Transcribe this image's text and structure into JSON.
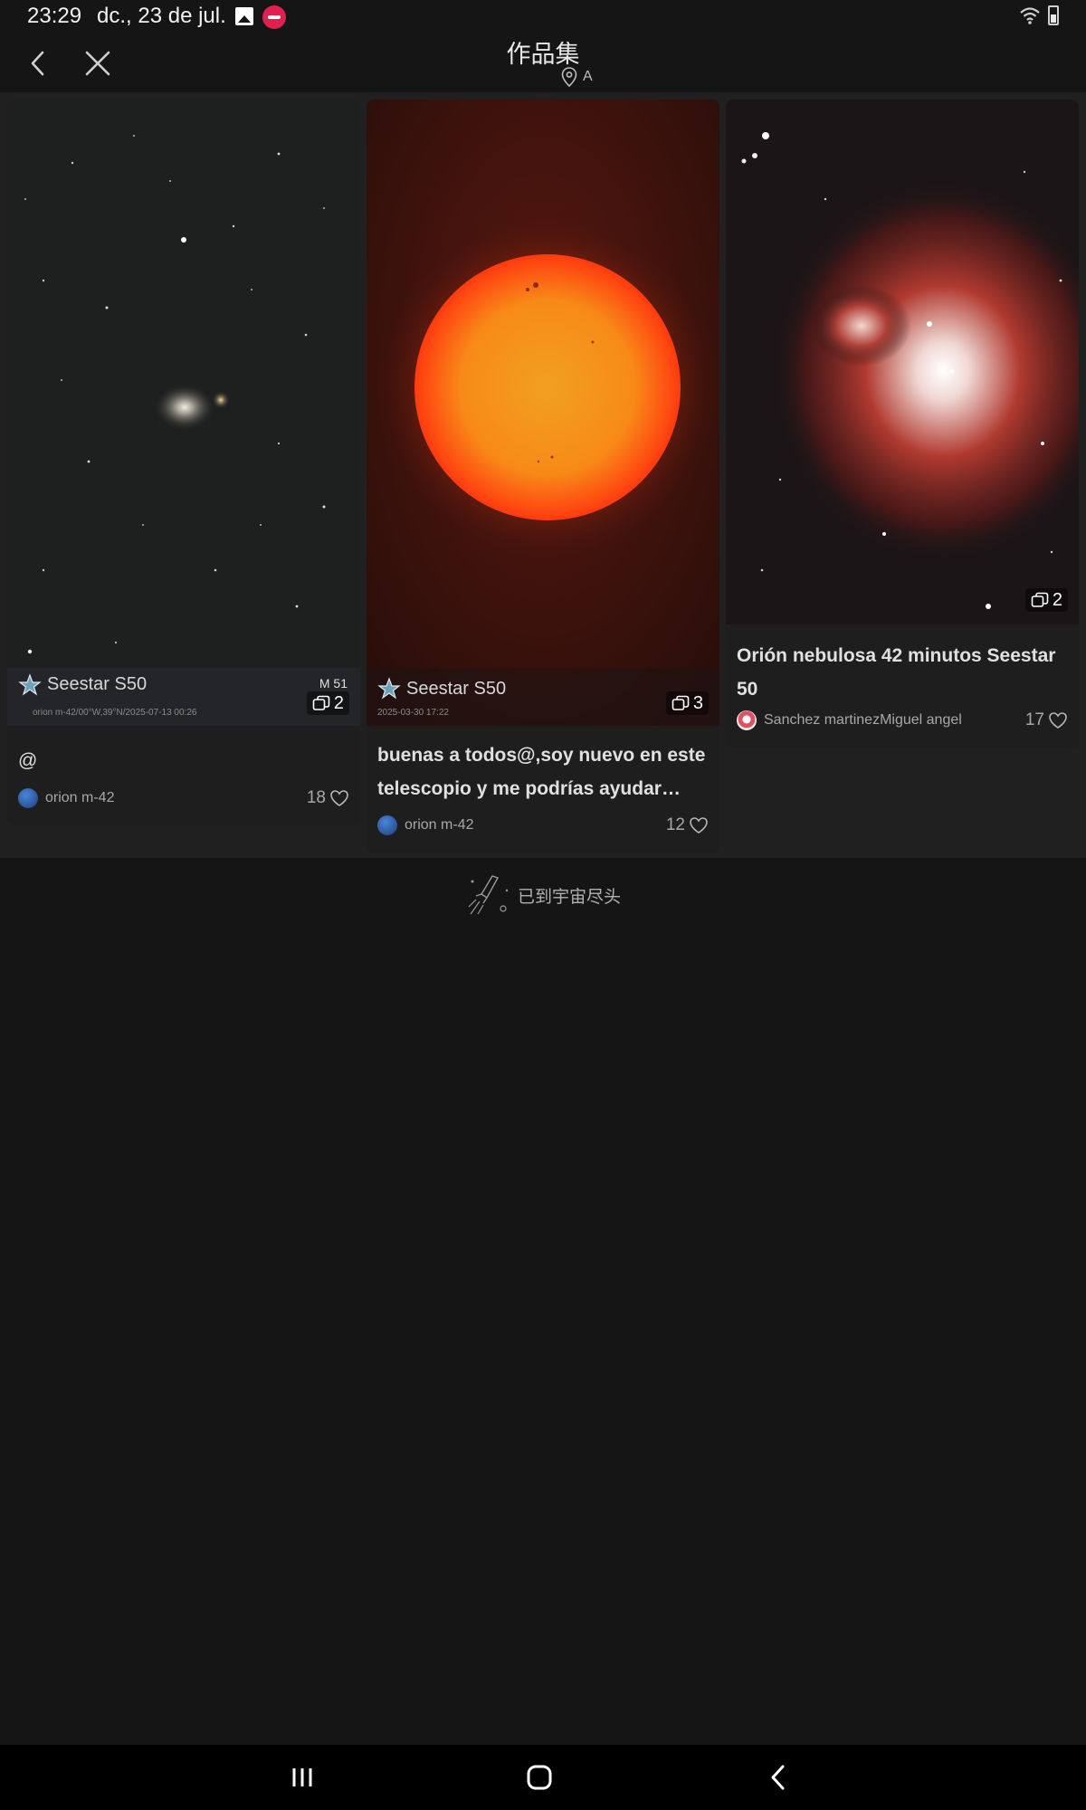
{
  "status_bar": {
    "time": "23:29",
    "date": "dc., 23 de jul."
  },
  "header": {
    "title": "作品集",
    "location": "A"
  },
  "cards": [
    {
      "watermark_brand": "Seestar S50",
      "watermark_target": "M 51",
      "watermark_info": "orion m-42/00°W,39°N/2025-07-13 00:26",
      "photo_count": "2",
      "title": "@",
      "author": "orion m-42",
      "likes": "18"
    },
    {
      "watermark_brand": "Seestar S50",
      "watermark_info": "2025-03-30 17:22",
      "photo_count": "3",
      "title": "buenas a todos@,soy nuevo en este telescopio y me podrías ayudar…",
      "author": "orion m-42",
      "likes": "12"
    },
    {
      "photo_count": "2",
      "title": "Orión nebulosa 42 minutos Seestar 50",
      "author": "Sanchez martinezMiguel angel",
      "likes": "17"
    }
  ],
  "end_message": "已到宇宙尽头",
  "colors": {
    "background": "#151515",
    "feed_background": "#202020",
    "card_background": "#1e1e1e",
    "sun_outer": "#ff3a10",
    "sun_inner": "#f0a020"
  },
  "icons": {
    "back": "chevron-left-icon",
    "close": "close-icon",
    "location": "location-pin-icon",
    "photos": "photo-stack-icon",
    "like": "heart-outline-icon",
    "end": "rocket-icon"
  }
}
